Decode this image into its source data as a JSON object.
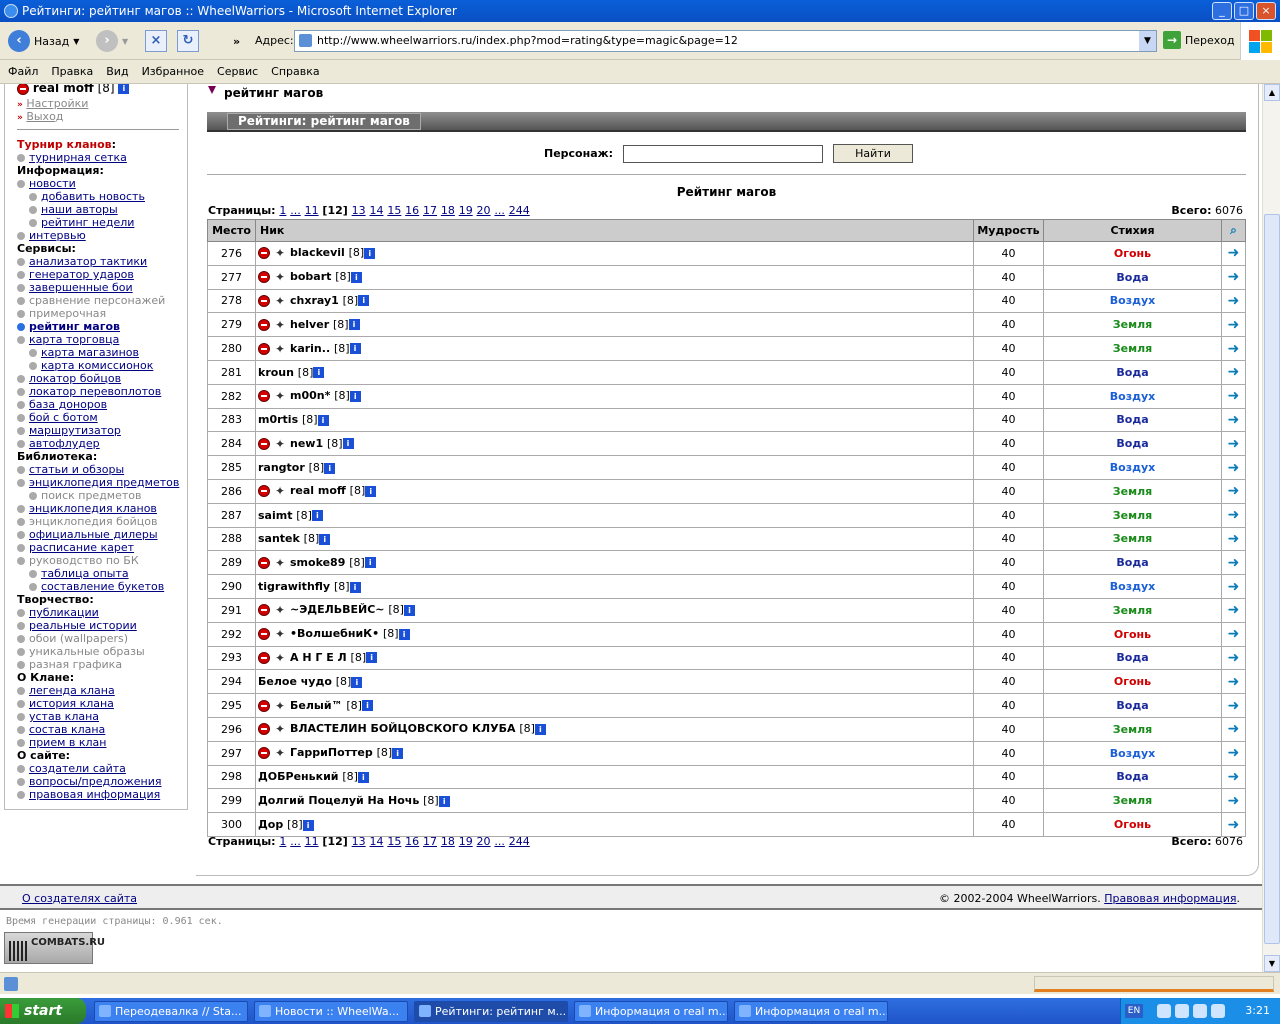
{
  "window": {
    "title": "Рейтинги: рейтинг магов :: WheelWarriors - Microsoft Internet Explorer"
  },
  "toolbar": {
    "back_label": "Назад",
    "address_label": "Адрес:",
    "url": "http://www.wheelwarriors.ru/index.php?mod=rating&type=magic&page=12",
    "go_label": "Переход"
  },
  "menu": [
    "Файл",
    "Правка",
    "Вид",
    "Избранное",
    "Сервис",
    "Справка"
  ],
  "sidebar": {
    "user": "real moff",
    "user_level": "[8]",
    "settings": "Настройки",
    "logout": "Выход",
    "tournament_heading": "Турнир кланов",
    "tournament_grid": "турнирная сетка",
    "info_heading": "Информация:",
    "info_items": [
      "новости",
      "добавить новость",
      "наши авторы",
      "рейтинг недели",
      "интервью"
    ],
    "services_heading": "Сервисы:",
    "services_items": [
      "анализатор тактики",
      "генератор ударов",
      "завершенные бои",
      "сравнение персонажей",
      "примерочная",
      "рейтинг магов",
      "карта торговца",
      "карта магазинов",
      "карта комиссионок",
      "локатор бойцов",
      "локатор перевоплотов",
      "база доноров",
      "бой с ботом",
      "маршрутизатор",
      "автофлудер"
    ],
    "library_heading": "Библиотека:",
    "library_items": [
      "статьи и обзоры",
      "энциклопедия предметов",
      "поиск предметов",
      "энциклопедия кланов",
      "энциклопедия бойцов",
      "официальные дилеры",
      "расписание карет",
      "руководство по БК",
      "таблица опыта",
      "составление букетов"
    ],
    "creative_heading": "Творчество:",
    "creative_items": [
      "публикации",
      "реальные истории",
      "обои (wallpapers)",
      "уникальные образы",
      "разная графика"
    ],
    "clan_heading": "О Клане:",
    "clan_items": [
      "легенда клана",
      "история клана",
      "устав клана",
      "состав клана",
      "прием в клан"
    ],
    "site_heading": "О сайте:",
    "site_items": [
      "создатели сайта",
      "вопросы/предложения",
      "правовая информация"
    ]
  },
  "content": {
    "breadcrumb": "рейтинг магов",
    "section_title": "Рейтинги: рейтинг магов",
    "search_label": "Персонаж:",
    "search_button": "Найти",
    "rating_title": "Рейтинг магов",
    "pages_label": "Страницы:",
    "pages_links_before": [
      "1",
      "...",
      "11"
    ],
    "current_page": "[12]",
    "pages_links_after": [
      "13",
      "14",
      "15",
      "16",
      "17",
      "18",
      "19",
      "20",
      "...",
      "244"
    ],
    "total_label": "Всего:",
    "total_value": "6076",
    "columns": [
      "Место",
      "Ник",
      "Мудрость",
      "Стихия"
    ],
    "rows": [
      {
        "place": "276",
        "nick": "blackevil",
        "level": "[8]",
        "wisdom": "40",
        "element": "Огонь",
        "clan": true
      },
      {
        "place": "277",
        "nick": "bobart",
        "level": "[8]",
        "wisdom": "40",
        "element": "Вода",
        "clan": true
      },
      {
        "place": "278",
        "nick": "chxray1",
        "level": "[8]",
        "wisdom": "40",
        "element": "Воздух",
        "clan": true
      },
      {
        "place": "279",
        "nick": "helver",
        "level": "[8]",
        "wisdom": "40",
        "element": "Земля",
        "clan": true
      },
      {
        "place": "280",
        "nick": "karin..",
        "level": "[8]",
        "wisdom": "40",
        "element": "Земля",
        "clan": true
      },
      {
        "place": "281",
        "nick": "kroun",
        "level": "[8]",
        "wisdom": "40",
        "element": "Вода",
        "clan": false
      },
      {
        "place": "282",
        "nick": "m00n*",
        "level": "[8]",
        "wisdom": "40",
        "element": "Воздух",
        "clan": true
      },
      {
        "place": "283",
        "nick": "m0rtis",
        "level": "[8]",
        "wisdom": "40",
        "element": "Вода",
        "clan": false
      },
      {
        "place": "284",
        "nick": "new1",
        "level": "[8]",
        "wisdom": "40",
        "element": "Вода",
        "clan": true
      },
      {
        "place": "285",
        "nick": "rangtor",
        "level": "[8]",
        "wisdom": "40",
        "element": "Воздух",
        "clan": false
      },
      {
        "place": "286",
        "nick": "real moff",
        "level": "[8]",
        "wisdom": "40",
        "element": "Земля",
        "clan": true
      },
      {
        "place": "287",
        "nick": "saimt",
        "level": "[8]",
        "wisdom": "40",
        "element": "Земля",
        "clan": false
      },
      {
        "place": "288",
        "nick": "santek",
        "level": "[8]",
        "wisdom": "40",
        "element": "Земля",
        "clan": false
      },
      {
        "place": "289",
        "nick": "smoke89",
        "level": "[8]",
        "wisdom": "40",
        "element": "Вода",
        "clan": true
      },
      {
        "place": "290",
        "nick": "tigrawithfly",
        "level": "[8]",
        "wisdom": "40",
        "element": "Воздух",
        "clan": false
      },
      {
        "place": "291",
        "nick": "~ЭДЕЛЬВЕЙС~",
        "level": "[8]",
        "wisdom": "40",
        "element": "Земля",
        "clan": true
      },
      {
        "place": "292",
        "nick": "•ВолшебниК•",
        "level": "[8]",
        "wisdom": "40",
        "element": "Огонь",
        "clan": true
      },
      {
        "place": "293",
        "nick": "А Н Г Е Л",
        "level": "[8]",
        "wisdom": "40",
        "element": "Вода",
        "clan": true
      },
      {
        "place": "294",
        "nick": "Белое чудо",
        "level": "[8]",
        "wisdom": "40",
        "element": "Огонь",
        "clan": false
      },
      {
        "place": "295",
        "nick": "Белый™",
        "level": "[8]",
        "wisdom": "40",
        "element": "Вода",
        "clan": true
      },
      {
        "place": "296",
        "nick": "ВЛАСТЕЛИН БОЙЦОВСКОГО КЛУБА",
        "level": "[8]",
        "wisdom": "40",
        "element": "Земля",
        "clan": true
      },
      {
        "place": "297",
        "nick": "ГарриПоттер",
        "level": "[8]",
        "wisdom": "40",
        "element": "Воздух",
        "clan": true
      },
      {
        "place": "298",
        "nick": "ДОБРенький",
        "level": "[8]",
        "wisdom": "40",
        "element": "Вода",
        "clan": false
      },
      {
        "place": "299",
        "nick": "Долгий Поцелуй На Ночь",
        "level": "[8]",
        "wisdom": "40",
        "element": "Земля",
        "clan": false
      },
      {
        "place": "300",
        "nick": "Дор",
        "level": "[8]",
        "wisdom": "40",
        "element": "Огонь",
        "clan": false
      }
    ]
  },
  "footer": {
    "about_link": "О создателях сайта",
    "copyright": "© 2002-2004 WheelWarriors.",
    "legal_link": "Правовая информация",
    "gen_time": "Время генерации страницы: 0.961 сек.",
    "counter": "COMBATS.RU"
  },
  "taskbar": {
    "start": "start",
    "tasks": [
      "Переодевалка // Sta...",
      "Новости :: WheelWa...",
      "Рейтинги: рейтинг м...",
      "Информация о real m...",
      "Информация о real m..."
    ],
    "lang": "EN",
    "clock": "3:21"
  },
  "colors": {
    "fire": "#d10000",
    "water": "#1a2a9a",
    "air": "#1a5fd8",
    "earth": "#1a8c1a"
  }
}
